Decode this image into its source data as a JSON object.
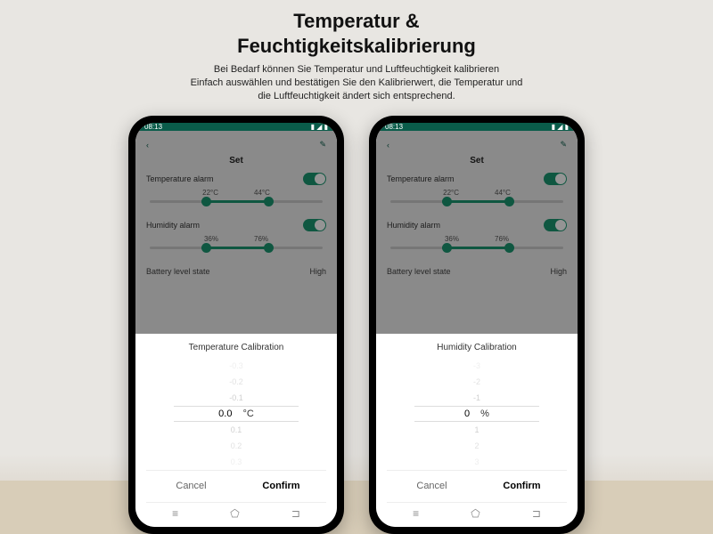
{
  "header": {
    "title_l1": "Temperatur &",
    "title_l2": "Feuchtigkeitskalibrierung",
    "desc_l1": "Bei Bedarf können Sie Temperatur und Luftfeuchtigkeit kalibrieren",
    "desc_l2": "Einfach auswählen und bestätigen Sie den Kalibrierwert, die Temperatur und",
    "desc_l3": "die Luftfeuchtigkeit ändert sich entsprechend."
  },
  "sys": {
    "time": "08:13"
  },
  "settings": {
    "page_title": "Set",
    "temp_alarm_label": "Temperature alarm",
    "temp_alarm_on": true,
    "temp_min": "22°C",
    "temp_max": "44°C",
    "hum_alarm_label": "Humidity alarm",
    "hum_alarm_on": true,
    "hum_min": "36%",
    "hum_max": "76%",
    "battery_label": "Battery level state",
    "battery_value": "High"
  },
  "picker_left": {
    "title": "Temperature Calibration",
    "options": [
      "-0.3",
      "-0.2",
      "-0.1",
      "0.0",
      "0.1",
      "0.2",
      "0.3"
    ],
    "selected": "0.0",
    "unit": "°C"
  },
  "picker_right": {
    "title": "Humidity Calibration",
    "options": [
      "-3",
      "-2",
      "-1",
      "0",
      "1",
      "2",
      "3"
    ],
    "selected": "0",
    "unit": "%"
  },
  "buttons": {
    "cancel": "Cancel",
    "confirm": "Confirm"
  },
  "nav_icons": {
    "menu": "≡",
    "home": "⬠",
    "back": "⊐"
  }
}
